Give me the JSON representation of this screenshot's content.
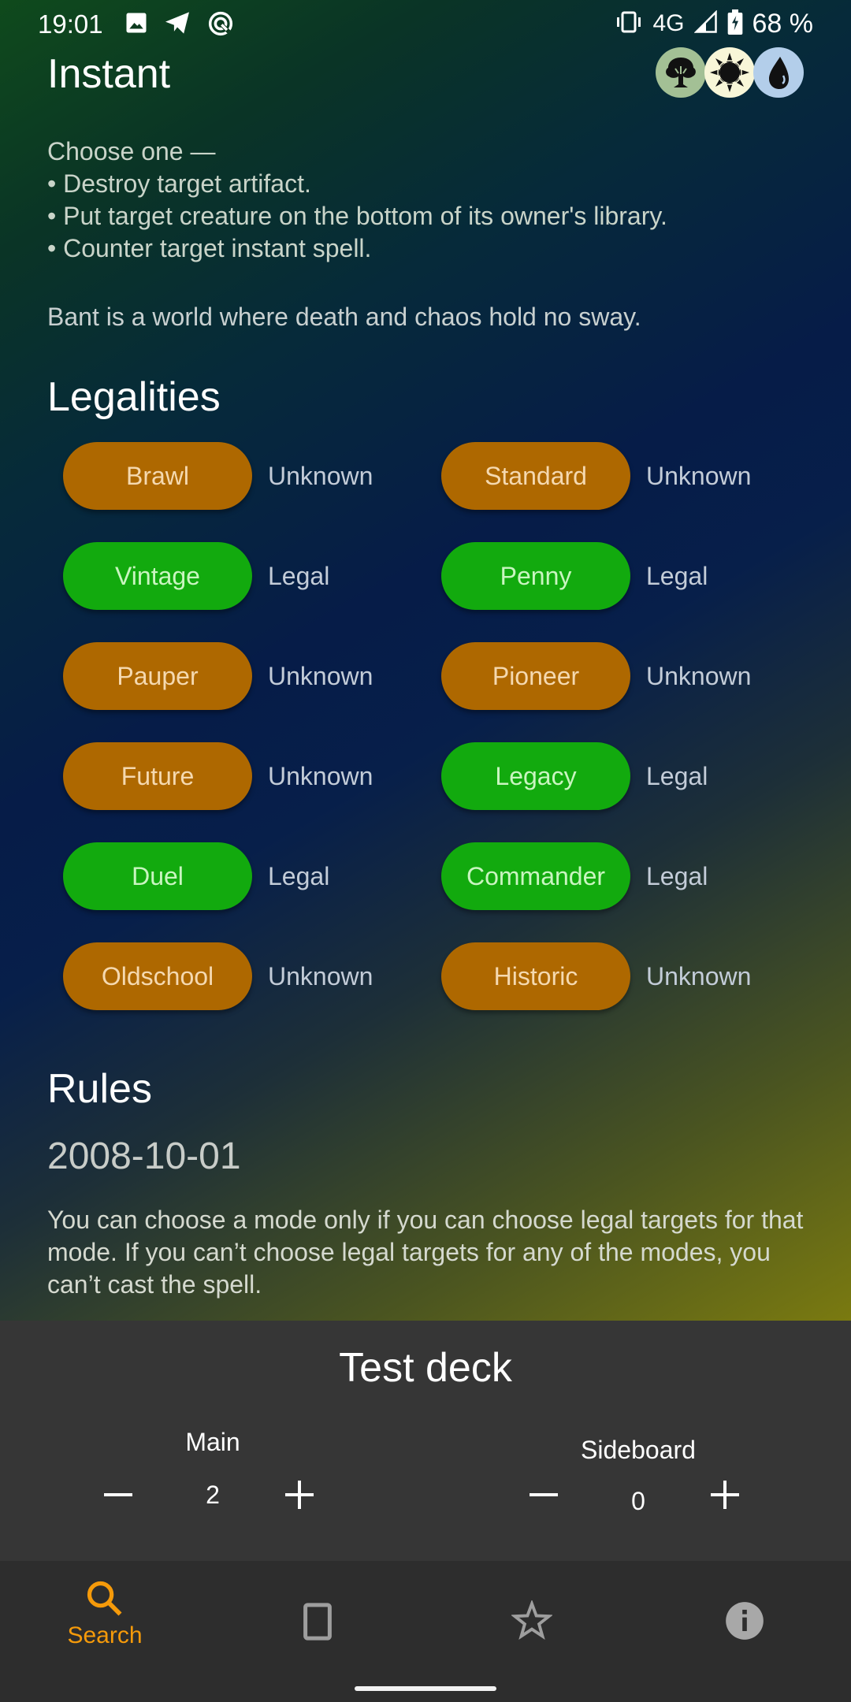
{
  "status_bar": {
    "time": "19:01",
    "left_icons": [
      "image-icon",
      "telegram-icon",
      "sync-icon"
    ],
    "network": "4G",
    "battery": "68 %",
    "right_icons": [
      "vibrate-icon",
      "signal-icon",
      "battery-charging-icon"
    ]
  },
  "card": {
    "type_line": "Instant",
    "mana_cost": [
      {
        "symbol": "G",
        "name": "green-mana-icon",
        "color": "#a3c095"
      },
      {
        "symbol": "W",
        "name": "white-mana-icon",
        "color": "#f8f6d8"
      },
      {
        "symbol": "U",
        "name": "blue-mana-icon",
        "color": "#b3ceea"
      }
    ],
    "oracle_lines": [
      "Choose one —",
      "• Destroy target artifact.",
      "• Put target creature on the bottom of its owner's library.",
      "• Counter target instant spell."
    ],
    "flavor_text": "Bant is a world where death and chaos hold no sway."
  },
  "legalities": {
    "title": "Legalities",
    "items": [
      {
        "format": "Brawl",
        "status": "Unknown"
      },
      {
        "format": "Standard",
        "status": "Unknown"
      },
      {
        "format": "Vintage",
        "status": "Legal"
      },
      {
        "format": "Penny",
        "status": "Legal"
      },
      {
        "format": "Pauper",
        "status": "Unknown"
      },
      {
        "format": "Pioneer",
        "status": "Unknown"
      },
      {
        "format": "Future",
        "status": "Unknown"
      },
      {
        "format": "Legacy",
        "status": "Legal"
      },
      {
        "format": "Duel",
        "status": "Legal"
      },
      {
        "format": "Commander",
        "status": "Legal"
      },
      {
        "format": "Oldschool",
        "status": "Unknown"
      },
      {
        "format": "Historic",
        "status": "Unknown"
      }
    ],
    "colors": {
      "legal": "#12aa0e",
      "unknown": "#ae6800"
    }
  },
  "rules": {
    "title": "Rules",
    "entries": [
      {
        "date": "2008-10-01",
        "text": "You can choose a mode only if you can choose legal targets for that mode. If you can’t choose legal targets for any of the modes, you can’t cast the spell."
      }
    ]
  },
  "deck": {
    "title": "Test deck",
    "main": {
      "label": "Main",
      "count": "2"
    },
    "sideboard": {
      "label": "Sideboard",
      "count": "0"
    }
  },
  "bottom_nav": {
    "items": [
      {
        "label": "Search",
        "icon": "search-icon",
        "active": true
      },
      {
        "label": "",
        "icon": "card-icon",
        "active": false
      },
      {
        "label": "",
        "icon": "star-icon",
        "active": false
      },
      {
        "label": "",
        "icon": "info-icon",
        "active": false
      }
    ],
    "accent": "#f59a0a"
  }
}
